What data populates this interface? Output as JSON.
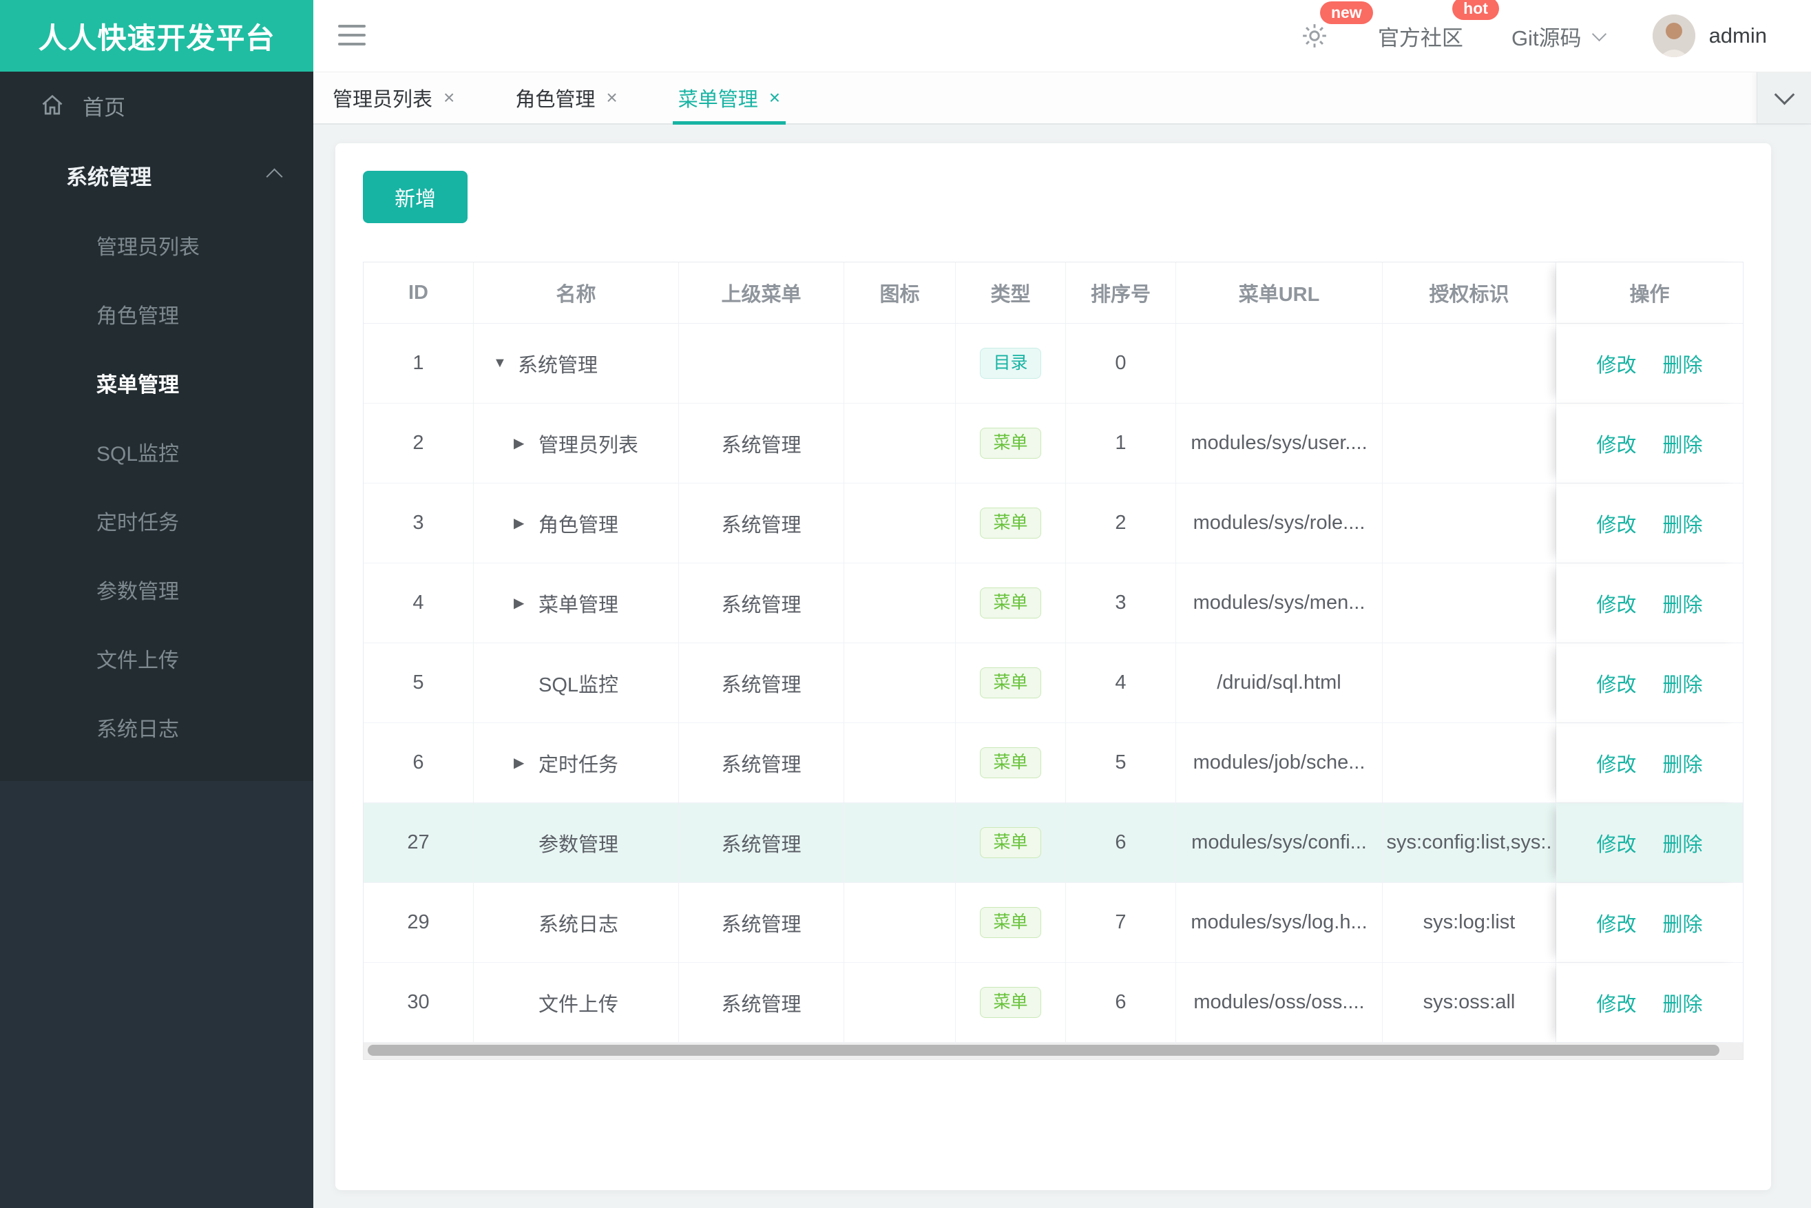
{
  "app": {
    "logo_title": "人人快速开发平台"
  },
  "header": {
    "badge_new": "new",
    "community_label": "官方社区",
    "badge_hot": "hot",
    "git_label": "Git源码",
    "username": "admin"
  },
  "sidebar": {
    "home_label": "首页",
    "group_label": "系统管理",
    "items": [
      {
        "label": "管理员列表",
        "active": false
      },
      {
        "label": "角色管理",
        "active": false
      },
      {
        "label": "菜单管理",
        "active": true
      },
      {
        "label": "SQL监控",
        "active": false
      },
      {
        "label": "定时任务",
        "active": false
      },
      {
        "label": "参数管理",
        "active": false
      },
      {
        "label": "文件上传",
        "active": false
      },
      {
        "label": "系统日志",
        "active": false
      }
    ]
  },
  "tabs": [
    {
      "label": "管理员列表",
      "active": false
    },
    {
      "label": "角色管理",
      "active": false
    },
    {
      "label": "菜单管理",
      "active": true
    }
  ],
  "tabs_close_glyph": "×",
  "toolbar": {
    "add_label": "新增"
  },
  "table": {
    "columns": [
      "ID",
      "名称",
      "上级菜单",
      "图标",
      "类型",
      "排序号",
      "菜单URL",
      "授权标识",
      "操作"
    ],
    "action_edit": "修改",
    "action_delete": "删除",
    "rows": [
      {
        "id": "1",
        "name": "系统管理",
        "arrow": "down",
        "indent": 0,
        "parent": "",
        "type": "目录",
        "order": "0",
        "url": "",
        "perm": "",
        "highlight": false
      },
      {
        "id": "2",
        "name": "管理员列表",
        "arrow": "right",
        "indent": 1,
        "parent": "系统管理",
        "type": "菜单",
        "order": "1",
        "url": "modules/sys/user....",
        "perm": "",
        "highlight": false
      },
      {
        "id": "3",
        "name": "角色管理",
        "arrow": "right",
        "indent": 1,
        "parent": "系统管理",
        "type": "菜单",
        "order": "2",
        "url": "modules/sys/role....",
        "perm": "",
        "highlight": false
      },
      {
        "id": "4",
        "name": "菜单管理",
        "arrow": "right",
        "indent": 1,
        "parent": "系统管理",
        "type": "菜单",
        "order": "3",
        "url": "modules/sys/men...",
        "perm": "",
        "highlight": false
      },
      {
        "id": "5",
        "name": "SQL监控",
        "arrow": "none",
        "indent": 1,
        "parent": "系统管理",
        "type": "菜单",
        "order": "4",
        "url": "/druid/sql.html",
        "perm": "",
        "highlight": false
      },
      {
        "id": "6",
        "name": "定时任务",
        "arrow": "right",
        "indent": 1,
        "parent": "系统管理",
        "type": "菜单",
        "order": "5",
        "url": "modules/job/sche...",
        "perm": "",
        "highlight": false
      },
      {
        "id": "27",
        "name": "参数管理",
        "arrow": "none",
        "indent": 1,
        "parent": "系统管理",
        "type": "菜单",
        "order": "6",
        "url": "modules/sys/confi...",
        "perm": "sys:config:list,sys:.",
        "highlight": true
      },
      {
        "id": "29",
        "name": "系统日志",
        "arrow": "none",
        "indent": 1,
        "parent": "系统管理",
        "type": "菜单",
        "order": "7",
        "url": "modules/sys/log.h...",
        "perm": "sys:log:list",
        "highlight": false
      },
      {
        "id": "30",
        "name": "文件上传",
        "arrow": "none",
        "indent": 1,
        "parent": "系统管理",
        "type": "菜单",
        "order": "6",
        "url": "modules/oss/oss....",
        "perm": "sys:oss:all",
        "highlight": false
      }
    ]
  },
  "colors": {
    "primary_teal": "#17b3a3",
    "logo_teal": "#20bda2",
    "sidebar_bg": "#27323a",
    "badge_red": "#fa6b62",
    "tag_dir_text": "#17b3a3",
    "tag_menu_text": "#67c23a",
    "row_highlight_bg": "#e8f6f3"
  }
}
